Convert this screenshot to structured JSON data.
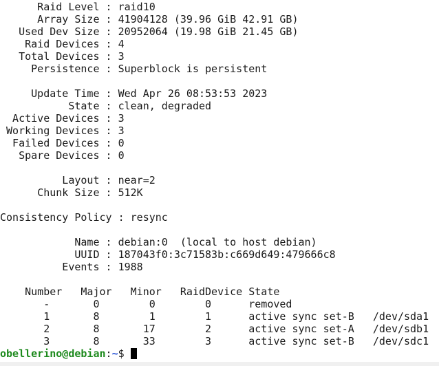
{
  "terminal": {
    "lines": [
      "      Raid Level : raid10",
      "      Array Size : 41904128 (39.96 GiB 42.91 GB)",
      "   Used Dev Size : 20952064 (19.98 GiB 21.45 GB)",
      "    Raid Devices : 4",
      "   Total Devices : 3",
      "     Persistence : Superblock is persistent",
      "",
      "     Update Time : Wed Apr 26 08:53:53 2023",
      "           State : clean, degraded",
      "  Active Devices : 3",
      " Working Devices : 3",
      "  Failed Devices : 0",
      "   Spare Devices : 0",
      "",
      "          Layout : near=2",
      "      Chunk Size : 512K",
      "",
      "Consistency Policy : resync",
      "",
      "            Name : debian:0  (local to host debian)",
      "            UUID : 187043f0:3c71583b:c669d649:479666c8",
      "          Events : 1988",
      "",
      "    Number   Major   Minor   RaidDevice State",
      "       -       0        0        0      removed",
      "       1       8        1        1      active sync set-B   /dev/sda1",
      "       2       8       17        2      active sync set-A   /dev/sdb1",
      "       3       8       33        3      active sync set-B   /dev/sdc1"
    ],
    "prompt": {
      "user_host": "obellerino@debian",
      "separator": ":",
      "path": "~",
      "symbol": "$ "
    }
  }
}
